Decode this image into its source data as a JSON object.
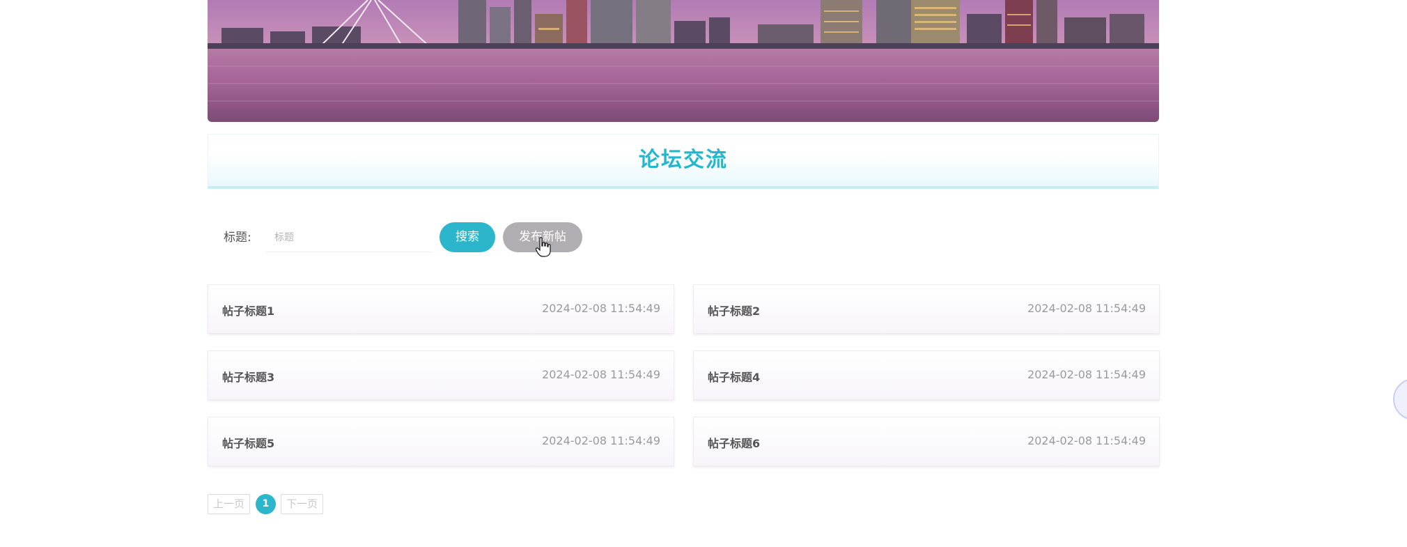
{
  "section": {
    "title": "论坛交流"
  },
  "search": {
    "label": "标题:",
    "placeholder": "标题",
    "value": "",
    "search_button": "搜索",
    "new_post_button": "发布新帖"
  },
  "posts": [
    {
      "title": "帖子标题1",
      "time": "2024-02-08 11:54:49"
    },
    {
      "title": "帖子标题2",
      "time": "2024-02-08 11:54:49"
    },
    {
      "title": "帖子标题3",
      "time": "2024-02-08 11:54:49"
    },
    {
      "title": "帖子标题4",
      "time": "2024-02-08 11:54:49"
    },
    {
      "title": "帖子标题5",
      "time": "2024-02-08 11:54:49"
    },
    {
      "title": "帖子标题6",
      "time": "2024-02-08 11:54:49"
    }
  ],
  "pagination": {
    "prev_label": "上一页",
    "current_page": "1",
    "next_label": "下一页"
  },
  "colors": {
    "accent": "#2cb6cc",
    "secondary_button": "#b1aeb3",
    "title_color": "#22b7cf"
  },
  "icons": {
    "cursor": "hand-pointer-icon",
    "banner": "city-skyline-banner",
    "floating_widget": "floating-widget-circle"
  }
}
